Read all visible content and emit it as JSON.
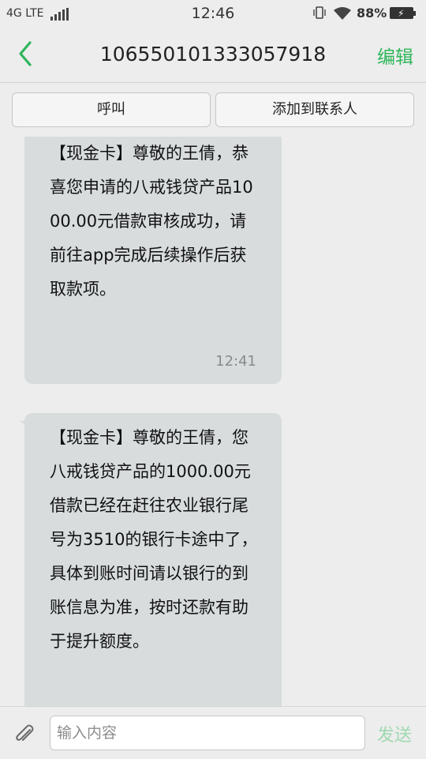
{
  "status_bar": {
    "network": "4G LTE",
    "time": "12:46",
    "battery": "88%"
  },
  "header": {
    "title": "106550101333057918",
    "edit_label": "编辑"
  },
  "actions": {
    "call_label": "呼叫",
    "add_contact_label": "添加到联系人"
  },
  "messages": [
    {
      "text": "【现金卡】尊敬的王倩，恭喜您申请的八戒钱贷产品1000.00元借款审核成功，请前往app完成后续操作后获取款项。",
      "time": "12:41"
    },
    {
      "text": "【现金卡】尊敬的王倩，您八戒钱贷产品的1000.00元借款已经在赶往农业银行尾号为3510的银行卡途中了，具体到账时间请以银行的到账信息为准，按时还款有助于提升额度。",
      "time": ""
    }
  ],
  "composer": {
    "placeholder": "输入内容",
    "send_label": "发送"
  },
  "colors": {
    "accent": "#2eb65a",
    "bubble": "#d8dcdd",
    "background": "#ededed"
  }
}
